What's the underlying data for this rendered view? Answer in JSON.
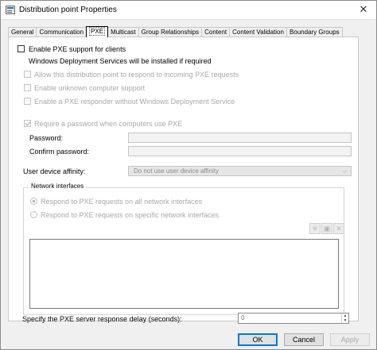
{
  "window": {
    "title": "Distribution point Properties",
    "close_glyph": "✕"
  },
  "tabs": [
    {
      "label": "General"
    },
    {
      "label": "Communication"
    },
    {
      "label": "PXE"
    },
    {
      "label": "Multicast"
    },
    {
      "label": "Group Relationships"
    },
    {
      "label": "Content"
    },
    {
      "label": "Content Validation"
    },
    {
      "label": "Boundary Groups"
    }
  ],
  "active_tab": "PXE",
  "pxe": {
    "enable_label": "Enable PXE support for clients",
    "enable_checked": false,
    "wds_note": "Windows Deployment Services will be installed if required",
    "options": [
      {
        "label": "Allow this distribution point to respond to incoming PXE requests",
        "checked": false
      },
      {
        "label": "Enable unknown computer support",
        "checked": false
      },
      {
        "label": "Enable a PXE responder without Windows Deployment Service",
        "checked": false
      }
    ],
    "require_password_label": "Require a password when computers use PXE",
    "require_password_checked": true,
    "password_label": "Password:",
    "password_value": "",
    "confirm_label": "Confirm password:",
    "confirm_value": "",
    "affinity_label": "User device affinity:",
    "affinity_value": "Do not use user device affinity",
    "network_group_label": "Network interfaces",
    "radio_all": "Respond to PXE requests on all network interfaces",
    "radio_specific": "Respond to PXE requests on specific network interfaces",
    "selected_radio": "all",
    "iface_buttons": [
      {
        "icon": "new-icon",
        "glyph": "✳"
      },
      {
        "icon": "properties-icon",
        "glyph": "▣"
      },
      {
        "icon": "delete-icon",
        "glyph": "✕"
      }
    ],
    "delay_label": "Specify the PXE server response delay (seconds):",
    "delay_value": "0"
  },
  "buttons": {
    "ok": "OK",
    "cancel": "Cancel",
    "apply": "Apply"
  }
}
